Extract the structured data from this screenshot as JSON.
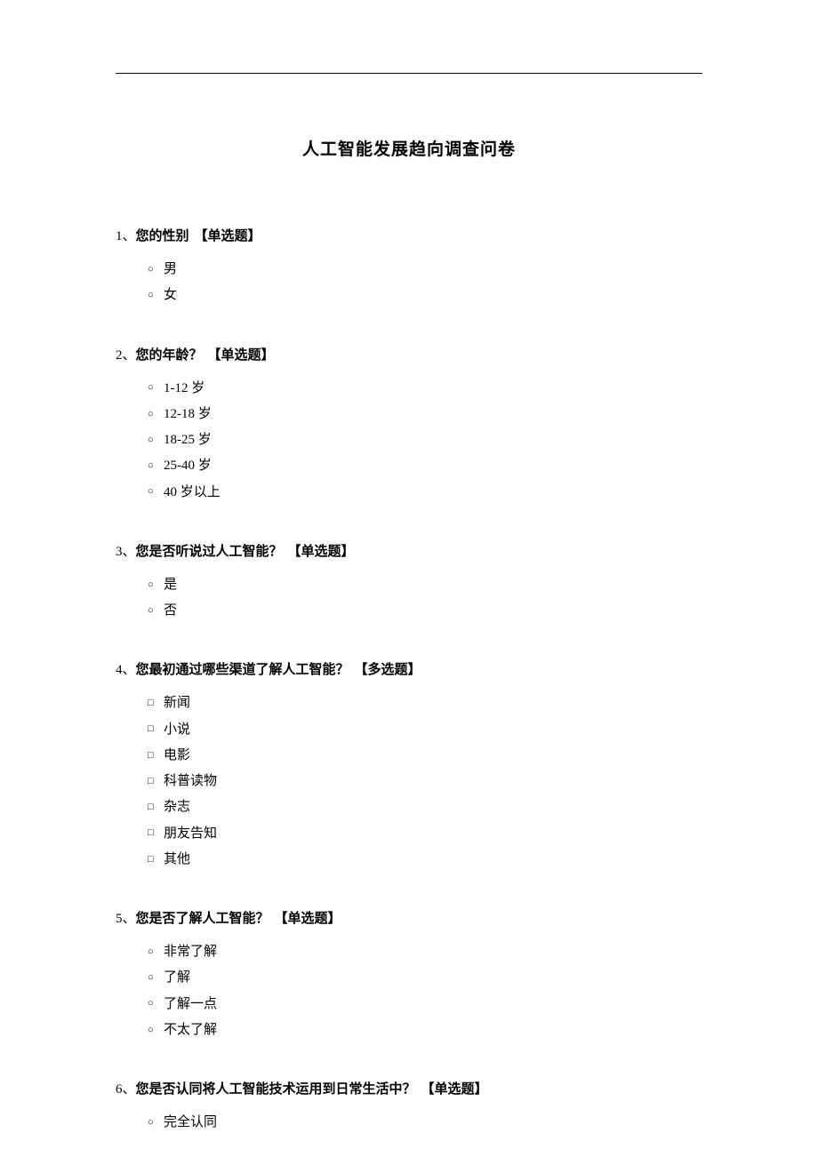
{
  "title": "人工智能发展趋向调查问卷",
  "type_labels": {
    "single": "【单选题】",
    "multi": "【多选题】"
  },
  "questions": [
    {
      "num": "1、",
      "text": "您的性别",
      "type": "single",
      "options": [
        "男",
        "女"
      ]
    },
    {
      "num": "2、",
      "text": "您的年龄？",
      "type": "single",
      "options": [
        "1-12 岁",
        "12-18 岁",
        "18-25 岁",
        "25-40 岁",
        "40 岁以上"
      ]
    },
    {
      "num": "3、",
      "text": "您是否听说过人工智能？",
      "type": "single",
      "options": [
        "是",
        "否"
      ]
    },
    {
      "num": "4、",
      "text": "您最初通过哪些渠道了解人工智能？",
      "type": "multi",
      "options": [
        "新闻",
        "小说",
        "电影",
        "科普读物",
        "杂志",
        "朋友告知",
        "其他"
      ]
    },
    {
      "num": "5、",
      "text": "您是否了解人工智能？",
      "type": "single",
      "options": [
        "非常了解",
        "了解",
        "了解一点",
        "不太了解"
      ]
    },
    {
      "num": "6、",
      "text": "您是否认同将人工智能技术运用到日常生活中？",
      "type": "single",
      "options": [
        "完全认同"
      ]
    }
  ]
}
